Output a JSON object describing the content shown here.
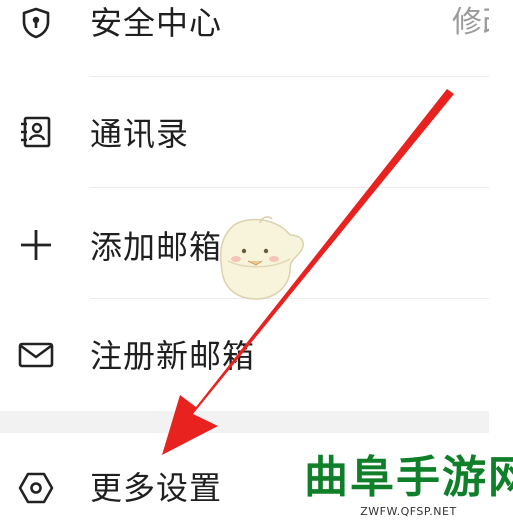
{
  "menu": {
    "security": {
      "label": "安全中心",
      "right_text": "修改",
      "icon": "shield-lock-icon"
    },
    "contacts": {
      "label": "通讯录",
      "icon": "contacts-book-icon"
    },
    "add_mailbox": {
      "label": "添加邮箱",
      "icon": "plus-icon"
    },
    "register_mailbox": {
      "label": "注册新邮箱",
      "icon": "envelope-icon"
    },
    "more_settings": {
      "label": "更多设置",
      "icon": "hexagon-settings-icon"
    }
  },
  "overlays": {
    "arrow_color": "#e8231f",
    "watermark_title": "曲阜手游网",
    "watermark_url": "ZWFW.QFSP.NET",
    "watermark_color": "#0f7f2a",
    "mascot_icon": "bird-mascot"
  }
}
